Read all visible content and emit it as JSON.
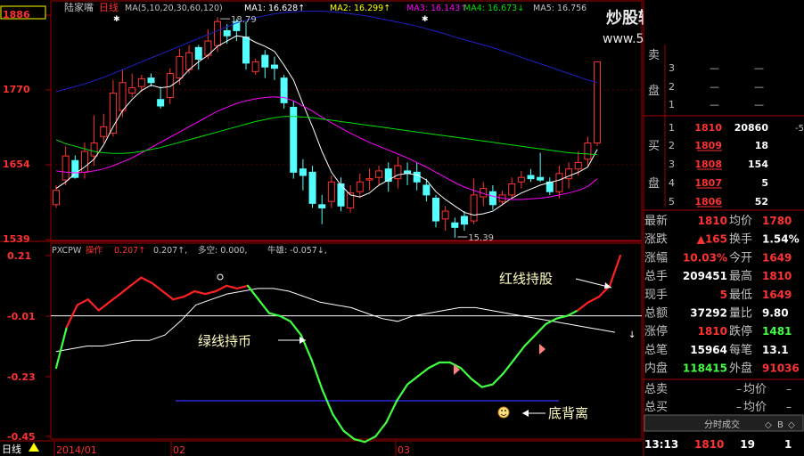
{
  "colors": {
    "up": "#ff3232",
    "down": "#54ffff",
    "frame": "#a00000",
    "label_red": "#ff3030",
    "label_gray": "#c0c0c0",
    "ma1": "#ffffff",
    "ma2": "#ffff00",
    "ma3": "#ff00ff",
    "ma4": "#00e000",
    "ma5": "#2020c8",
    "ind_red": "#ff2020",
    "ind_green": "#40ff40",
    "ind_white": "#ffffff",
    "divergence_line": "#3030ff",
    "annot": "#ffffc0",
    "yellow": "#ffff00"
  },
  "header": {
    "stock_name": "陆家嘴",
    "period": "日线",
    "ma_params": "MA(5,10,20,30,60,120)",
    "ma1": "MA1: 16.628↑",
    "ma2": "MA2: 16.299↑",
    "ma3": "MA3: 16.143↑",
    "ma4": "MA4: 16.673↓",
    "ma5": "MA5: 16.756"
  },
  "watermark": {
    "line1": "炒股辅助教材58股网",
    "line2": "www.58Gu.com"
  },
  "price_axis": {
    "labels": [
      "1886",
      "1770",
      "1654",
      "1539"
    ]
  },
  "indicator": {
    "name": "PXCPW",
    "main_label": "操作",
    "main_value": "0.207↑",
    "value2": "0.207↑,",
    "duokong": "多空: 0.000,",
    "niuxiong": "牛雄: -0.057↓,",
    "axis_labels": [
      "0.21",
      "-0.01",
      "-0.23",
      "-0.45"
    ]
  },
  "annotations": {
    "high_price": "18.79",
    "low_price": "15.39",
    "red_hold": "红线持股",
    "green_hold": "绿线持币",
    "bottom_divergence": "底背离"
  },
  "date_axis": {
    "period_button": "日线",
    "labels": [
      "2014/01",
      "02",
      "03"
    ]
  },
  "chart_data": {
    "type": "candlestick",
    "ylim": [
      15.39,
      18.86
    ],
    "candles": [
      [
        15.9,
        16.12,
        15.85,
        16.2
      ],
      [
        16.28,
        16.65,
        16.2,
        16.8
      ],
      [
        16.58,
        16.32,
        16.3,
        16.66
      ],
      [
        16.4,
        16.72,
        16.3,
        16.86
      ],
      [
        16.65,
        16.85,
        16.5,
        17.28
      ],
      [
        16.95,
        17.1,
        16.85,
        17.3
      ],
      [
        17.0,
        17.62,
        16.95,
        17.82
      ],
      [
        17.35,
        17.78,
        17.25,
        17.98
      ],
      [
        17.62,
        17.7,
        17.55,
        17.92
      ],
      [
        17.72,
        17.84,
        17.64,
        17.9
      ],
      [
        17.85,
        17.78,
        17.72,
        17.92
      ],
      [
        17.52,
        17.42,
        17.38,
        17.72
      ],
      [
        17.55,
        17.92,
        17.45,
        18.0
      ],
      [
        17.85,
        18.18,
        17.75,
        18.3
      ],
      [
        17.98,
        18.24,
        17.92,
        18.36
      ],
      [
        18.32,
        18.14,
        17.98,
        18.36
      ],
      [
        18.2,
        18.42,
        18.14,
        18.6
      ],
      [
        18.35,
        18.72,
        18.25,
        18.79
      ],
      [
        18.58,
        18.5,
        18.38,
        18.68
      ],
      [
        18.72,
        18.58,
        18.42,
        18.76
      ],
      [
        18.48,
        18.08,
        17.98,
        18.72
      ],
      [
        17.95,
        18.1,
        17.9,
        18.15
      ],
      [
        18.2,
        18.02,
        17.85,
        18.28
      ],
      [
        18.05,
        18.0,
        17.82,
        18.18
      ],
      [
        17.85,
        17.47,
        17.38,
        17.9
      ],
      [
        17.4,
        16.4,
        16.3,
        17.5
      ],
      [
        16.45,
        16.35,
        16.12,
        16.6
      ],
      [
        16.4,
        15.92,
        15.85,
        16.5
      ],
      [
        15.9,
        15.85,
        15.6,
        16.05
      ],
      [
        15.95,
        16.25,
        15.85,
        16.35
      ],
      [
        16.22,
        15.88,
        15.8,
        16.32
      ],
      [
        15.85,
        16.08,
        15.78,
        16.2
      ],
      [
        16.1,
        16.25,
        16.0,
        16.38
      ],
      [
        16.28,
        16.3,
        16.12,
        16.46
      ],
      [
        16.32,
        16.42,
        16.2,
        16.5
      ],
      [
        16.45,
        16.26,
        16.1,
        16.55
      ],
      [
        16.3,
        16.5,
        16.15,
        16.64
      ],
      [
        16.42,
        16.38,
        16.2,
        16.55
      ],
      [
        16.4,
        16.25,
        16.12,
        16.55
      ],
      [
        16.2,
        16.05,
        15.95,
        16.3
      ],
      [
        16.0,
        15.65,
        15.55,
        16.05
      ],
      [
        15.68,
        15.8,
        15.5,
        15.88
      ],
      [
        15.62,
        15.55,
        15.39,
        15.7
      ],
      [
        15.72,
        15.6,
        15.5,
        15.8
      ],
      [
        15.65,
        16.05,
        15.6,
        16.3
      ],
      [
        16.02,
        16.15,
        15.88,
        16.25
      ],
      [
        16.1,
        15.9,
        15.82,
        16.2
      ],
      [
        15.95,
        16.05,
        15.9,
        16.12
      ],
      [
        16.05,
        16.22,
        16.0,
        16.32
      ],
      [
        16.25,
        16.32,
        16.15,
        16.42
      ],
      [
        16.35,
        16.3,
        16.25,
        16.45
      ],
      [
        16.32,
        16.28,
        16.25,
        16.7
      ],
      [
        16.25,
        16.1,
        16.05,
        16.32
      ],
      [
        16.1,
        16.38,
        16.0,
        16.5
      ],
      [
        16.3,
        16.45,
        16.15,
        16.55
      ],
      [
        16.45,
        16.55,
        16.35,
        16.72
      ],
      [
        16.6,
        16.85,
        16.5,
        16.95
      ],
      [
        16.85,
        18.1,
        16.8,
        18.1
      ]
    ],
    "ma_series": [
      {
        "name": "MA1",
        "values": [
          16.15,
          16.25,
          16.38,
          16.48,
          16.6,
          16.82,
          17.1,
          17.35,
          17.52,
          17.66,
          17.74,
          17.7,
          17.72,
          17.82,
          17.98,
          18.1,
          18.2,
          18.34,
          18.42,
          18.5,
          18.48,
          18.4,
          18.34,
          18.26,
          18.05,
          17.82,
          17.45,
          17.1,
          16.72,
          16.4,
          16.2,
          16.05,
          16.02,
          16.08,
          16.2,
          16.28,
          16.36,
          16.38,
          16.36,
          16.28,
          16.1,
          15.98,
          15.88,
          15.78,
          15.74,
          15.76,
          15.8,
          15.9,
          16.0,
          16.08,
          16.14,
          16.2,
          16.24,
          16.28,
          16.34,
          16.4,
          16.48,
          16.75
        ]
      },
      {
        "name": "MA3",
        "values": [
          16.42,
          16.4,
          16.39,
          16.4,
          16.42,
          16.45,
          16.5,
          16.56,
          16.62,
          16.7,
          16.78,
          16.86,
          16.94,
          17.02,
          17.1,
          17.18,
          17.26,
          17.34,
          17.4,
          17.46,
          17.5,
          17.53,
          17.55,
          17.56,
          17.55,
          17.5,
          17.42,
          17.34,
          17.25,
          17.16,
          17.08,
          17.0,
          16.93,
          16.86,
          16.8,
          16.74,
          16.68,
          16.62,
          16.55,
          16.48,
          16.4,
          16.32,
          16.24,
          16.17,
          16.12,
          16.07,
          16.03,
          16.0,
          15.98,
          15.98,
          15.99,
          16.0,
          16.02,
          16.05,
          16.08,
          16.12,
          16.18,
          16.3
        ]
      },
      {
        "name": "MA4",
        "values": [
          16.9,
          16.84,
          16.8,
          16.76,
          16.72,
          16.7,
          16.69,
          16.69,
          16.7,
          16.72,
          16.75,
          16.78,
          16.82,
          16.86,
          16.9,
          16.94,
          16.98,
          17.02,
          17.06,
          17.1,
          17.14,
          17.18,
          17.21,
          17.24,
          17.26,
          17.26,
          17.25,
          17.24,
          17.22,
          17.2,
          17.18,
          17.16,
          17.14,
          17.12,
          17.1,
          17.08,
          17.06,
          17.04,
          17.02,
          17.0,
          16.98,
          16.96,
          16.94,
          16.92,
          16.9,
          16.88,
          16.86,
          16.84,
          16.82,
          16.8,
          16.78,
          16.76,
          16.74,
          16.72,
          16.7,
          16.69,
          16.68,
          16.67
        ]
      },
      {
        "name": "MA5",
        "values": [
          17.64,
          17.68,
          17.72,
          17.76,
          17.81,
          17.86,
          17.92,
          17.98,
          18.04,
          18.1,
          18.16,
          18.22,
          18.28,
          18.34,
          18.4,
          18.46,
          18.52,
          18.58,
          18.64,
          18.7,
          18.74,
          18.78,
          18.81,
          18.84,
          18.86,
          18.87,
          18.88,
          18.88,
          18.88,
          18.87,
          18.86,
          18.84,
          18.82,
          18.8,
          18.77,
          18.74,
          18.71,
          18.68,
          18.65,
          18.61,
          18.57,
          18.53,
          18.48,
          18.44,
          18.4,
          18.36,
          18.32,
          18.27,
          18.22,
          18.17,
          18.12,
          18.07,
          18.02,
          17.97,
          17.92,
          17.87,
          17.82,
          17.78
        ]
      }
    ],
    "indicator_ylim": [
      -0.45,
      0.21
    ],
    "indicator_red": [
      -0.2,
      -0.05,
      0.03,
      0.05,
      0.01,
      0.04,
      0.07,
      0.1,
      0.13,
      0.11,
      0.08,
      0.05,
      0.06,
      0.08,
      0.07,
      0.08,
      0.1,
      0.09,
      0.1,
      0.05,
      0.0,
      -0.01,
      -0.03,
      -0.08,
      -0.17,
      -0.28,
      -0.37,
      -0.43,
      -0.46,
      -0.47,
      -0.45,
      -0.4,
      -0.32,
      -0.26,
      -0.23,
      -0.2,
      -0.18,
      -0.18,
      -0.2,
      -0.24,
      -0.27,
      -0.26,
      -0.22,
      -0.17,
      -0.12,
      -0.08,
      -0.04,
      -0.02,
      -0.01,
      0.01,
      0.04,
      0.06,
      0.1,
      0.21
    ],
    "indicator_white": [
      -0.14,
      -0.13,
      -0.12,
      -0.12,
      -0.11,
      -0.1,
      -0.1,
      -0.08,
      -0.03,
      0.03,
      0.05,
      0.07,
      0.08,
      0.09,
      0.09,
      0.08,
      0.06,
      0.04,
      0.03,
      0.02,
      0.0,
      -0.02,
      -0.03,
      -0.01,
      0.0,
      0.01,
      0.02,
      0.02,
      0.01,
      0.0,
      -0.01,
      -0.02,
      -0.03,
      -0.04,
      -0.05,
      -0.06,
      -0.07
    ],
    "divergence_level": -0.32
  },
  "quote_panel": {
    "sell_label": "卖",
    "sell_label2": "盘",
    "buy_label": "买",
    "buy_label2": "盘",
    "asks": [
      {
        "idx": "3",
        "price": "—",
        "vol": "—"
      },
      {
        "idx": "2",
        "price": "—",
        "vol": "—"
      },
      {
        "idx": "1",
        "price": "—",
        "vol": "—"
      }
    ],
    "bids": [
      {
        "idx": "1",
        "price": "1810",
        "vol": "20860",
        "extra": "-5"
      },
      {
        "idx": "2",
        "price": "1809",
        "vol": "18",
        "extra": ""
      },
      {
        "idx": "3",
        "price": "1808",
        "vol": "154",
        "extra": ""
      },
      {
        "idx": "4",
        "price": "1807",
        "vol": "5",
        "extra": ""
      },
      {
        "idx": "5",
        "price": "1806",
        "vol": "52",
        "extra": ""
      }
    ],
    "stats": [
      {
        "l1": "最新",
        "v1": "1810",
        "c1": "up",
        "l2": "均价",
        "v2": "1780",
        "c2": "up"
      },
      {
        "l1": "涨跌",
        "v1": "▲165",
        "c1": "up",
        "l2": "换手",
        "v2": "1.54%",
        "c2": "white"
      },
      {
        "l1": "涨幅",
        "v1": "10.03%",
        "c1": "up",
        "l2": "今开",
        "v2": "1649",
        "c2": "up"
      },
      {
        "l1": "总手",
        "v1": "209451",
        "c1": "white",
        "l2": "最高",
        "v2": "1810",
        "c2": "up"
      },
      {
        "l1": "现手",
        "v1": "5",
        "c1": "up",
        "l2": "最低",
        "v2": "1649",
        "c2": "up"
      },
      {
        "l1": "总额",
        "v1": "37292",
        "c1": "white",
        "l2": "量比",
        "v2": "9.80",
        "c2": "white"
      },
      {
        "l1": "涨停",
        "v1": "1810",
        "c1": "up",
        "l2": "跌停",
        "v2": "1481",
        "c2": "green"
      },
      {
        "l1": "总笔",
        "v1": "15964",
        "c1": "white",
        "l2": "每笔",
        "v2": "13.1",
        "c2": "white"
      },
      {
        "l1": "内盘",
        "v1": "118415",
        "c1": "green",
        "l2": "外盘",
        "v2": "91036",
        "c2": "up"
      }
    ],
    "total_sell": {
      "label": "总卖",
      "v1": "–",
      "l2": "均价",
      "v2": "–"
    },
    "total_buy": {
      "label": "总买",
      "v1": "–",
      "l2": "均价",
      "v2": "–"
    },
    "tick_tab": "分时成交",
    "tick_tab_icon": "◇",
    "tick_tab_icon2": "◇",
    "tick_side": "B",
    "last_tick": {
      "time": "13:13",
      "price": "1810",
      "vol": "19",
      "mark": "1"
    }
  }
}
